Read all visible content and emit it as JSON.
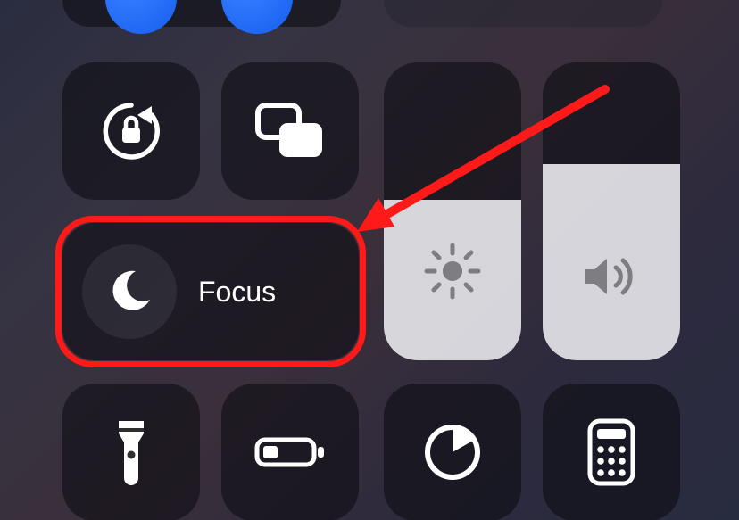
{
  "focus": {
    "label": "Focus"
  },
  "brightness": {
    "level_percent": 54
  },
  "volume": {
    "level_percent": 66
  },
  "icons": {
    "orientation_lock": "orientation-lock-icon",
    "screen_mirroring": "screen-mirroring-icon",
    "focus_moon": "moon-icon",
    "brightness_sun": "sun-icon",
    "volume_speaker": "speaker-icon",
    "flashlight": "flashlight-icon",
    "low_power": "battery-icon",
    "timer": "timer-icon",
    "calculator": "calculator-icon"
  },
  "annotation": {
    "target": "focus-tile",
    "color": "#ff1a1a"
  }
}
